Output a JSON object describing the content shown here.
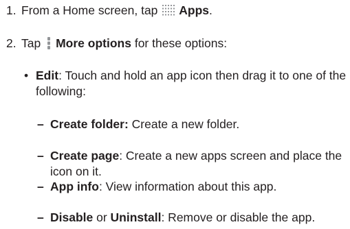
{
  "steps": [
    {
      "number": "1.",
      "before": "From a Home screen, tap",
      "icon": "apps-grid-icon",
      "bold": "Apps",
      "after": "."
    },
    {
      "number": "2.",
      "before": "Tap",
      "icon": "more-options-icon",
      "bold": "More options",
      "after": "for these options:"
    }
  ],
  "bullet": {
    "marker": "•",
    "bold": "Edit",
    "text": ": Touch and hold an app icon then drag it to one of the following:"
  },
  "subitems": [
    {
      "marker": "–",
      "bold": "Create folder:",
      "text": " Create a new folder."
    },
    {
      "marker": "–",
      "bold": "Create page",
      "text": ": Create a new apps screen and place the icon on it."
    },
    {
      "marker": "–",
      "bold": "App info",
      "text": ": View information about this app."
    },
    {
      "marker": "–",
      "bold": "Disable",
      "middle": " or ",
      "bold2": "Uninstall",
      "text": ": Remove or disable the app."
    }
  ],
  "colors": {
    "text": "#231f20",
    "icon": "#939598"
  }
}
